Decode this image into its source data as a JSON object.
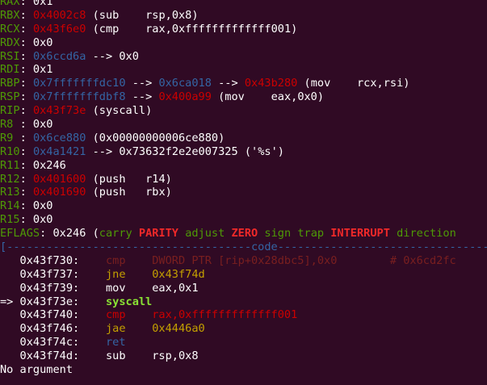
{
  "colors": {
    "background": "#300a24",
    "green": "#4e9a06",
    "red": "#cc0000",
    "blue": "#3465a4",
    "yellow": "#c4a000",
    "bright_green": "#8ae234",
    "bright_red": "#ef2929",
    "text": "#ffffff"
  },
  "registers_section": {
    "lines": [
      [
        {
          "t": "RAX",
          "c": "green"
        },
        {
          "t": ": 0x1",
          "c": "default"
        }
      ],
      [
        {
          "t": "RBX",
          "c": "green"
        },
        {
          "t": ": ",
          "c": "default"
        },
        {
          "t": "0x4002c8",
          "c": "red"
        },
        {
          "t": " (sub    rsp,0x8)",
          "c": "default"
        }
      ],
      [
        {
          "t": "RCX",
          "c": "green"
        },
        {
          "t": ": ",
          "c": "default"
        },
        {
          "t": "0x43f6e0",
          "c": "red"
        },
        {
          "t": " (cmp    rax,0xfffffffffffff001)",
          "c": "default"
        }
      ],
      [
        {
          "t": "RDX",
          "c": "green"
        },
        {
          "t": ": 0x0",
          "c": "default"
        }
      ],
      [
        {
          "t": "RSI",
          "c": "green"
        },
        {
          "t": ": ",
          "c": "default"
        },
        {
          "t": "0x6ccd6a",
          "c": "blue"
        },
        {
          "t": " --> 0x0",
          "c": "default"
        }
      ],
      [
        {
          "t": "RDI",
          "c": "green"
        },
        {
          "t": ": 0x1",
          "c": "default"
        }
      ],
      [
        {
          "t": "RBP",
          "c": "green"
        },
        {
          "t": ": ",
          "c": "default"
        },
        {
          "t": "0x7fffffffdc10",
          "c": "blue"
        },
        {
          "t": " --> ",
          "c": "default"
        },
        {
          "t": "0x6ca018",
          "c": "blue"
        },
        {
          "t": " --> ",
          "c": "default"
        },
        {
          "t": "0x43b280",
          "c": "red"
        },
        {
          "t": " (mov    rcx,rsi)",
          "c": "default"
        }
      ],
      [
        {
          "t": "RSP",
          "c": "green"
        },
        {
          "t": ": ",
          "c": "default"
        },
        {
          "t": "0x7fffffffdbf8",
          "c": "blue"
        },
        {
          "t": " --> ",
          "c": "default"
        },
        {
          "t": "0x400a99",
          "c": "red"
        },
        {
          "t": " (mov    eax,0x0)",
          "c": "default"
        }
      ],
      [
        {
          "t": "RIP",
          "c": "green"
        },
        {
          "t": ": ",
          "c": "default"
        },
        {
          "t": "0x43f73e",
          "c": "red"
        },
        {
          "t": " (syscall)",
          "c": "default"
        }
      ],
      [
        {
          "t": "R8 ",
          "c": "green"
        },
        {
          "t": ": 0x0",
          "c": "default"
        }
      ],
      [
        {
          "t": "R9 ",
          "c": "green"
        },
        {
          "t": ": ",
          "c": "default"
        },
        {
          "t": "0x6ce880",
          "c": "blue"
        },
        {
          "t": " (0x00000000006ce880)",
          "c": "default"
        }
      ],
      [
        {
          "t": "R10",
          "c": "green"
        },
        {
          "t": ": ",
          "c": "default"
        },
        {
          "t": "0x4a1421",
          "c": "blue"
        },
        {
          "t": " --> 0x73632f2e2e007325 ('%s')",
          "c": "default"
        }
      ],
      [
        {
          "t": "R11",
          "c": "green"
        },
        {
          "t": ": 0x246",
          "c": "default"
        }
      ],
      [
        {
          "t": "R12",
          "c": "green"
        },
        {
          "t": ": ",
          "c": "default"
        },
        {
          "t": "0x401600",
          "c": "red"
        },
        {
          "t": " (push   r14)",
          "c": "default"
        }
      ],
      [
        {
          "t": "R13",
          "c": "green"
        },
        {
          "t": ": ",
          "c": "default"
        },
        {
          "t": "0x401690",
          "c": "red"
        },
        {
          "t": " (push   rbx)",
          "c": "default"
        }
      ],
      [
        {
          "t": "R14",
          "c": "green"
        },
        {
          "t": ": 0x0",
          "c": "default"
        }
      ],
      [
        {
          "t": "R15",
          "c": "green"
        },
        {
          "t": ": 0x0",
          "c": "default"
        }
      ],
      [
        {
          "t": "EFLAGS",
          "c": "green"
        },
        {
          "t": ": 0x246 (",
          "c": "default"
        },
        {
          "t": "carry ",
          "c": "green"
        },
        {
          "t": "PARITY ",
          "c": "bred"
        },
        {
          "t": "adjust ",
          "c": "green"
        },
        {
          "t": "ZERO ",
          "c": "bred"
        },
        {
          "t": "sign trap ",
          "c": "green"
        },
        {
          "t": "INTERRUPT ",
          "c": "bred"
        },
        {
          "t": "direction",
          "c": "green"
        }
      ]
    ]
  },
  "code_section": {
    "lines": [
      [
        {
          "t": "[-------------------------------------code-------------------------------------]",
          "c": "blue"
        }
      ],
      [
        {
          "t": "   0x43f730:    ",
          "c": "default"
        },
        {
          "t": "cmp    DWORD PTR [rip+0x28dbc5],0x0        # 0x6cd2fc",
          "c": "dim"
        }
      ],
      [
        {
          "t": "   0x43f737:    ",
          "c": "default"
        },
        {
          "t": "jne    ",
          "c": "yellow"
        },
        {
          "t": "0x43f74d",
          "c": "yellow"
        }
      ],
      [
        {
          "t": "   0x43f739:    ",
          "c": "default"
        },
        {
          "t": "mov    eax,0x1",
          "c": "default"
        }
      ],
      [
        {
          "t": "=> 0x43f73e:    ",
          "c": "default"
        },
        {
          "t": "syscall",
          "c": "bgreen"
        }
      ],
      [
        {
          "t": "   0x43f740:    ",
          "c": "default"
        },
        {
          "t": "cmp    rax,0xfffffffffffff001",
          "c": "red"
        }
      ],
      [
        {
          "t": "   0x43f746:    ",
          "c": "default"
        },
        {
          "t": "jae    ",
          "c": "yellow"
        },
        {
          "t": "0x4446a0",
          "c": "yellow"
        }
      ],
      [
        {
          "t": "   0x43f74c:    ",
          "c": "default"
        },
        {
          "t": "ret",
          "c": "blue"
        }
      ],
      [
        {
          "t": "   0x43f74d:    ",
          "c": "default"
        },
        {
          "t": "sub    rsp,0x8",
          "c": "default"
        }
      ],
      [
        {
          "t": "No argument",
          "c": "default"
        }
      ]
    ]
  }
}
